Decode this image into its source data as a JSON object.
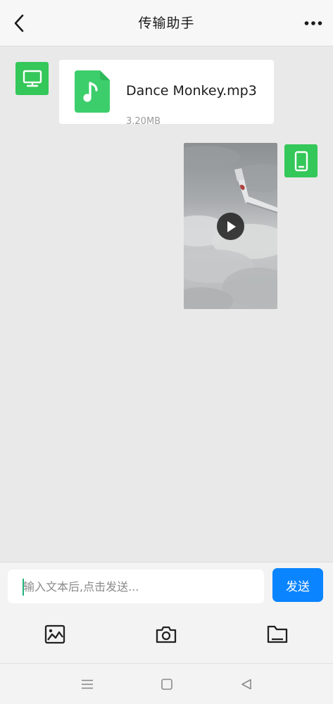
{
  "header": {
    "title": "传输助手",
    "back_icon": "chevron-left-icon",
    "more_icon": "more-horizontal-icon"
  },
  "messages": [
    {
      "type": "file",
      "direction": "incoming",
      "sender_icon": "desktop-monitor-icon",
      "file_icon": "music-note-icon",
      "file_name": "Dance Monkey.mp3",
      "file_size": "3.20MB"
    },
    {
      "type": "video",
      "direction": "outgoing",
      "sender_icon": "mobile-phone-icon",
      "play_icon": "play-icon"
    }
  ],
  "composer": {
    "placeholder": "输入文本后,点击发送...",
    "value": "",
    "send_label": "发送"
  },
  "toolbar": [
    {
      "id": "image",
      "icon": "image-icon"
    },
    {
      "id": "camera",
      "icon": "camera-icon"
    },
    {
      "id": "folder",
      "icon": "folder-icon"
    }
  ],
  "system_nav": [
    {
      "id": "menu",
      "icon": "menu-lines-icon"
    },
    {
      "id": "home",
      "icon": "square-home-icon"
    },
    {
      "id": "back",
      "icon": "triangle-back-icon"
    }
  ],
  "colors": {
    "accent_green": "#34c759",
    "send_blue": "#0a84ff",
    "chat_background": "#e9e9e9",
    "bar_background": "#f3f3f3"
  }
}
